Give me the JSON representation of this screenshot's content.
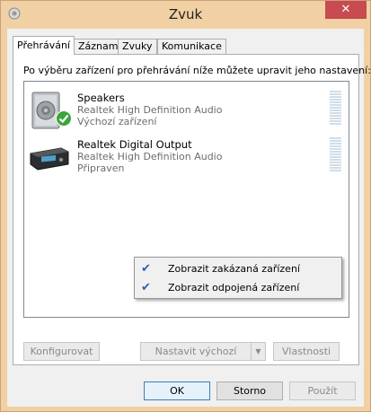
{
  "window": {
    "title": "Zvuk",
    "close_label": "✕"
  },
  "tabs": [
    {
      "label": "Přehrávání",
      "active": true
    },
    {
      "label": "Záznam",
      "active": false
    },
    {
      "label": "Zvuky",
      "active": false
    },
    {
      "label": "Komunikace",
      "active": false
    }
  ],
  "instructions": "Po výběru zařízení pro přehrávání níže můžete upravit jeho nastavení:",
  "devices": [
    {
      "name": "Speakers",
      "driver": "Realtek High Definition Audio",
      "status": "Výchozí zařízení",
      "icon": "speaker-icon",
      "default_badge": "checkmark-badge-icon"
    },
    {
      "name": "Realtek Digital Output",
      "driver": "Realtek High Definition Audio",
      "status": "Připraven",
      "icon": "digital-output-icon"
    }
  ],
  "context_menu": {
    "items": [
      {
        "label": "Zobrazit zakázaná zařízení",
        "checked": true
      },
      {
        "label": "Zobrazit odpojená zařízení",
        "checked": true
      }
    ]
  },
  "buttons": {
    "configure": "Konfigurovat",
    "set_default": "Nastavit výchozí",
    "properties": "Vlastnosti",
    "ok": "OK",
    "cancel": "Storno",
    "apply": "Použít"
  },
  "colors": {
    "frame": "#f1d0a3",
    "close": "#c74b50",
    "accent_check": "#2b5fb0",
    "default_badge": "#3aa53a"
  }
}
